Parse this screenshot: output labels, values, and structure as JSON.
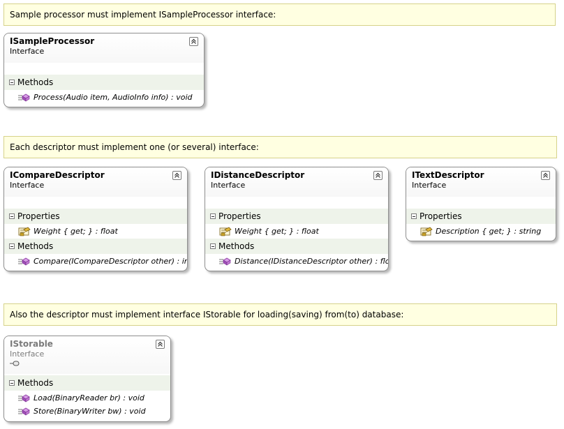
{
  "notes": {
    "n1": "Sample processor must implement ISampleProcessor interface:",
    "n2": "Each descriptor must implement one (or several) interface:",
    "n3": "Also the descriptor must implement interface IStorable for loading(saving) from(to) database:"
  },
  "shapes": {
    "sample_processor": {
      "name": "ISampleProcessor",
      "kind": "Interface",
      "methods_label": "Methods",
      "methods": [
        "Process(Audio item, AudioInfo info) : void"
      ]
    },
    "compare_descriptor": {
      "name": "ICompareDescriptor",
      "kind": "Interface",
      "properties_label": "Properties",
      "properties": [
        "Weight { get; } : float"
      ],
      "methods_label": "Methods",
      "methods": [
        "Compare(ICompareDescriptor other) : int"
      ]
    },
    "distance_descriptor": {
      "name": "IDistanceDescriptor",
      "kind": "Interface",
      "properties_label": "Properties",
      "properties": [
        "Weight { get; } : float"
      ],
      "methods_label": "Methods",
      "methods": [
        "Distance(IDistanceDescriptor other) : float"
      ]
    },
    "text_descriptor": {
      "name": "ITextDescriptor",
      "kind": "Interface",
      "properties_label": "Properties",
      "properties": [
        "Description { get; } : string"
      ]
    },
    "storable": {
      "name": "IStorable",
      "kind": "Interface",
      "methods_label": "Methods",
      "methods": [
        "Load(BinaryReader br) : void",
        "Store(BinaryWriter bw) : void"
      ]
    }
  },
  "colors": {
    "note_background": "#ffffe1",
    "section_background": "#eef3ea",
    "method_icon": "#b05bc7",
    "property_icon": "#c9a227"
  },
  "icons": {
    "collapse": "double-chevron-up-icon",
    "method": "method-icon",
    "property": "property-icon",
    "section_toggle": "minus-box-icon",
    "interface_lollipop": "lollipop-icon"
  }
}
